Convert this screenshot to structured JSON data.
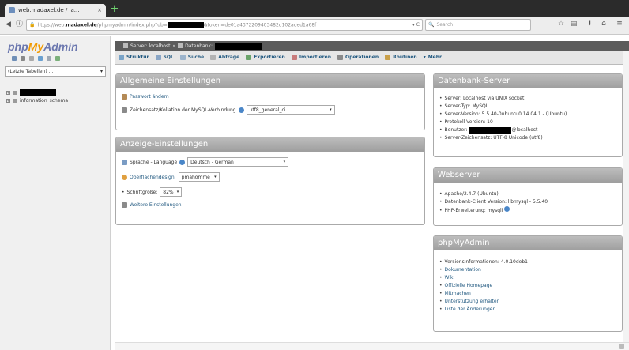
{
  "browser": {
    "tab_title": "web.madaxel.de / la...",
    "tab_close": "×",
    "new_tab": "+",
    "url_prefix": "https://web.",
    "url_domain": "madaxel.de",
    "url_path": "/phpmyadmin/index.php?db=",
    "url_tail": "&token=de01a4372209403482d102aded1a68f",
    "url_dropdown": "▾ C",
    "search_placeholder": "Search"
  },
  "sidebar": {
    "logo_php": "php",
    "logo_my": "My",
    "logo_admin": "Admin",
    "recent_label": "(Letzte Tabellen) ...",
    "tree": [
      {
        "name": ""
      },
      {
        "name": "information_schema"
      }
    ]
  },
  "breadcrumb": {
    "server": "Server: localhost",
    "separator": "»",
    "db_prefix": "Datenbank: "
  },
  "menu": [
    {
      "label": "Struktur",
      "color": "#7aa4c8"
    },
    {
      "label": "SQL",
      "color": "#8aa6c6"
    },
    {
      "label": "Suche",
      "color": "#9cb4cc"
    },
    {
      "label": "Abfrage",
      "color": "#b3b3b3"
    },
    {
      "label": "Exportieren",
      "color": "#6aa36a"
    },
    {
      "label": "Importieren",
      "color": "#c87b7b"
    },
    {
      "label": "Operationen",
      "color": "#8a8a8a"
    },
    {
      "label": "Routinen",
      "color": "#c9a04a"
    },
    {
      "label": "Mehr",
      "color": ""
    }
  ],
  "general": {
    "title": "Allgemeine Einstellungen",
    "password_link": "Passwort ändern",
    "collation_label": "Zeichensatz/Kollation der MySQL-Verbindung",
    "collation_value": "utf8_general_ci"
  },
  "display": {
    "title": "Anzeige-Einstellungen",
    "language_label": "Sprache - Language",
    "language_value": "Deutsch - German",
    "theme_label": "Oberflächendesign:",
    "theme_value": "pmahomme",
    "fontsize_label": "Schriftgröße:",
    "fontsize_value": "82%",
    "more_settings": "Weitere Einstellungen"
  },
  "dbserver": {
    "title": "Datenbank-Server",
    "items": [
      "Server: Localhost via UNIX socket",
      "Server-Typ: MySQL",
      "Server-Version: 5.5.40-0ubuntu0.14.04.1 - (Ubuntu)",
      "Protokoll-Version: 10",
      "Benutzer: ",
      "Server-Zeichensatz: UTF-8 Unicode (utf8)"
    ],
    "user_suffix": "@localhost"
  },
  "webserver": {
    "title": "Webserver",
    "items": [
      "Apache/2.4.7 (Ubuntu)",
      "Datenbank-Client Version: libmysql - 5.5.40",
      "PHP-Erweiterung: mysqli"
    ]
  },
  "pma": {
    "title": "phpMyAdmin",
    "version": "Versionsinformationen: 4.0.10deb1",
    "links": [
      "Dokumentation",
      "Wiki",
      "Offizielle Homepage",
      "Mitmachen",
      "Unterstützung erhalten",
      "Liste der Änderungen"
    ]
  }
}
